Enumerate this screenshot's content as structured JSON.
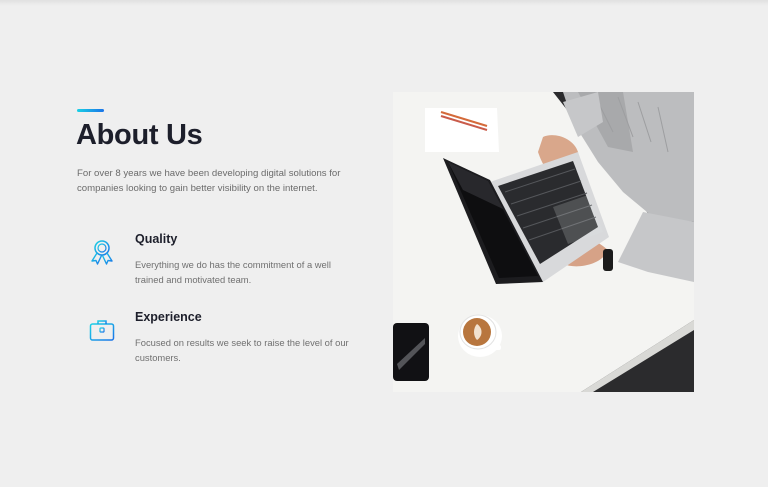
{
  "colors": {
    "accent_start": "#1ad1e5",
    "accent_end": "#1a73e8",
    "heading": "#1d1f2b",
    "body_text": "#6b6b6b",
    "background": "#efefef"
  },
  "about": {
    "title": "About Us",
    "intro": "For over 8 years we have been developing digital solutions for companies looking to gain better visibility on the internet."
  },
  "features": [
    {
      "icon": "award-ribbon-icon",
      "title": "Quality",
      "description": "Everything we do has the commitment of a well trained and motivated team."
    },
    {
      "icon": "briefcase-icon",
      "title": "Experience",
      "description": "Focused on results we seek to raise the level of our customers."
    }
  ],
  "image": {
    "subject": "person-typing-on-laptop-with-coffee-photo"
  }
}
